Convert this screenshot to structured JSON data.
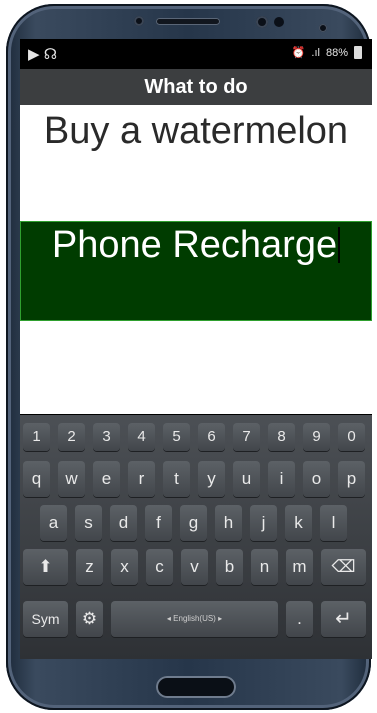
{
  "status_bar": {
    "left_glyphs": "▶ ☊",
    "alarm": "⏰",
    "signal": ".ıl",
    "battery": "88%"
  },
  "header": {
    "title": "What to do"
  },
  "items": [
    {
      "text": "Buy a watermelon"
    },
    {
      "text": "Phone Recharge"
    }
  ],
  "keyboard": {
    "numbers": [
      "1",
      "2",
      "3",
      "4",
      "5",
      "6",
      "7",
      "8",
      "9",
      "0"
    ],
    "row1": [
      "q",
      "w",
      "e",
      "r",
      "t",
      "y",
      "u",
      "i",
      "o",
      "p"
    ],
    "row2": [
      "a",
      "s",
      "d",
      "f",
      "g",
      "h",
      "j",
      "k",
      "l"
    ],
    "row3": [
      "⬆",
      "z",
      "x",
      "c",
      "v",
      "b",
      "n",
      "m",
      "⌫"
    ],
    "sym_label": "Sym",
    "settings_icon": "⚙",
    "space_label": "◂ English(US) ▸",
    "period": ".",
    "enter": "↵"
  }
}
